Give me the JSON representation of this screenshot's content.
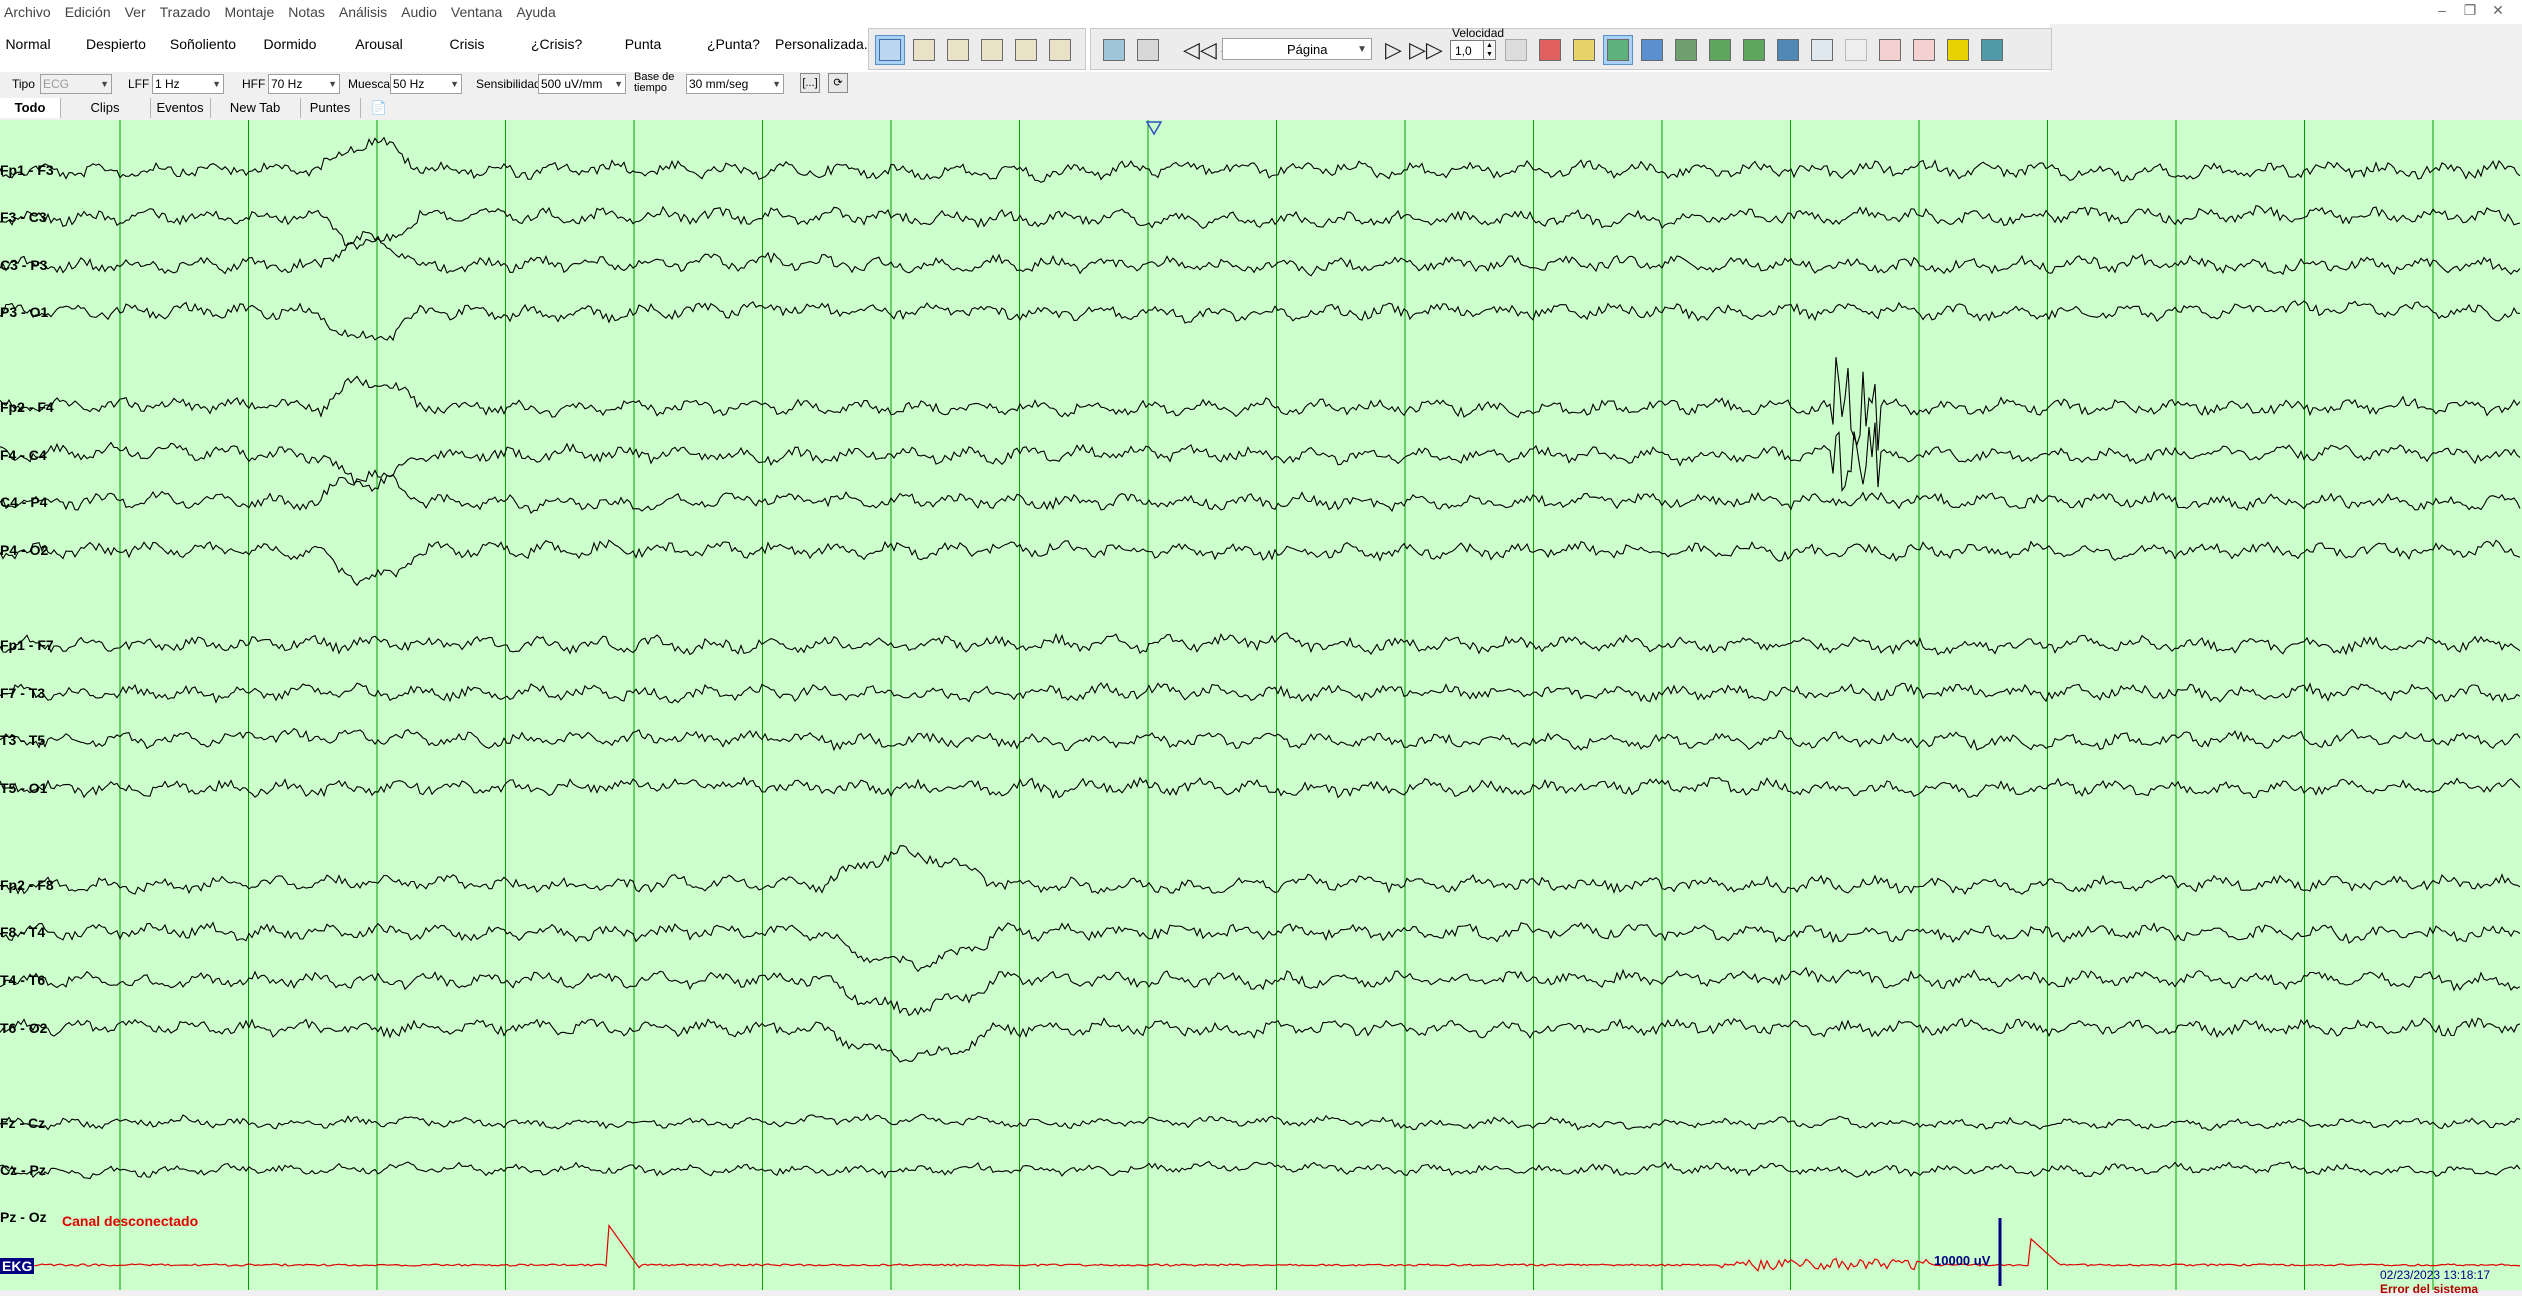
{
  "menu": {
    "items": [
      "Archivo",
      "Edición",
      "Ver",
      "Trazado",
      "Montaje",
      "Notas",
      "Análisis",
      "Audio",
      "Ventana",
      "Ayuda"
    ]
  },
  "event_buttons": [
    "Normal",
    "Despierto",
    "Soñoliento",
    "Dormido",
    "Arousal",
    "Crisis",
    "¿Crisis?",
    "Punta",
    "¿Punta?",
    "Personalizada..."
  ],
  "toolbar": {
    "page_mode": "Página",
    "speed_label": "Velocidad",
    "speed_value": "1,0"
  },
  "filters": {
    "tipo_label": "Tipo",
    "tipo_value": "ECG",
    "lff_label": "LFF",
    "lff_value": "1 Hz",
    "hff_label": "HFF",
    "hff_value": "70 Hz",
    "muesca_label": "Muesca",
    "muesca_value": "50 Hz",
    "sensibilidad_label": "Sensibilidad",
    "sensibilidad_value": "500 uV/mm",
    "base_tiempo_label_1": "Base de",
    "base_tiempo_label_2": "tiempo",
    "base_tiempo_value": "30 mm/seg",
    "bracket_btn": "[...]"
  },
  "tabs": [
    "Todo",
    "Clips",
    "Eventos",
    "New Tab",
    "Puntes"
  ],
  "channels": [
    {
      "label": "Fp1 - F3"
    },
    {
      "label": "F3 - C3"
    },
    {
      "label": "C3 - P3"
    },
    {
      "label": "P3 - O1"
    },
    {
      "label": "Fp2 - F4"
    },
    {
      "label": "F4 - C4"
    },
    {
      "label": "C4 - P4"
    },
    {
      "label": "P4 - O2"
    },
    {
      "label": "Fp1 - F7"
    },
    {
      "label": "F7 - T3"
    },
    {
      "label": "T3 - T5"
    },
    {
      "label": "T5 - O1"
    },
    {
      "label": "Fp2 - F8"
    },
    {
      "label": "F8 - T4"
    },
    {
      "label": "T4 - T6"
    },
    {
      "label": "T6 - O2"
    },
    {
      "label": "Fz - Cz"
    },
    {
      "label": "Cz - Pz"
    },
    {
      "label": "Pz - Oz"
    }
  ],
  "disconnected_text": "Canal desconectado",
  "ekg_label": "EKG",
  "scale_text": "10000 uV",
  "timestamp": "02/23/2023 13:18:17",
  "error_text": "Error del sistema",
  "colors": {
    "trace_bg": "#ccffcc",
    "grid_line": "#00a000",
    "trace": "#000000",
    "ekg_trace": "#e00000",
    "alert": "#e00000"
  }
}
